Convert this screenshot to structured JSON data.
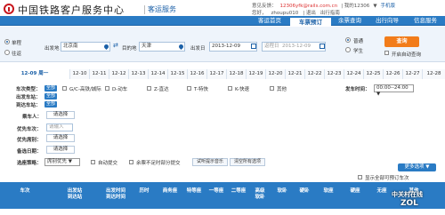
{
  "header": {
    "brand_title": "中国铁路客户服务中心",
    "brand_subtitle": "客运服务",
    "top_links": [
      "意见反馈：",
      "12306yfk@rails.com.cn",
      "| 我的12306",
      "▼",
      "手机版"
    ],
    "user_line": [
      "您好，",
      "zhoupu010",
      "| 退出",
      "出行指南"
    ]
  },
  "nav": {
    "tabs": [
      "客运首页",
      "车票预订",
      "余票查询",
      "出行向导",
      "信息服务"
    ],
    "active_index": 1
  },
  "search": {
    "trip_types": [
      "单程",
      "往返"
    ],
    "trip_selected": 0,
    "from_label": "出发地",
    "from_value": "北京南",
    "to_label": "目的地",
    "to_value": "天津",
    "date_label": "出发日",
    "date_value": "2013-12-09",
    "return_label": "返程日",
    "return_value": "2013-12-09",
    "passenger_types": [
      "普通",
      "学生"
    ],
    "passenger_selected": 0,
    "query_button": "查询",
    "auto_query_label": "开启自动查询"
  },
  "dates": [
    "12-09 周一",
    "12-10",
    "12-11",
    "12-12",
    "12-13",
    "12-14",
    "12-15",
    "12-16",
    "12-17",
    "12-18",
    "12-19",
    "12-20",
    "12-21",
    "12-22",
    "12-23",
    "12-24",
    "12-25",
    "12-26",
    "12-27",
    "12-28"
  ],
  "filters": {
    "train_type_label": "车次类型：",
    "all_label": "全部",
    "train_types": [
      "G/C-高铁/城际",
      "D-动车",
      "Z-直达",
      "T-特快",
      "K-快速",
      "其他"
    ],
    "depart_time_label": "发车时间：",
    "depart_time_value": "00:00--24:00",
    "from_station_label": "出发车站：",
    "to_station_label": "到达车站：",
    "passenger_label": "乘车人：",
    "choose_label": "请选择",
    "priority_train_label": "优先车次：",
    "priority_train_placeholder": "请输入",
    "priority_seat_label": "优先席别：",
    "alt_date_label": "备选日期：",
    "strategy_label": "选座策略：",
    "strategy_value": "席别优先",
    "auto_submit_label": "自动提交",
    "partial_submit_label": "余票不足时部分提交",
    "test_tip_button": "试听提示音乐",
    "clear_button": "清空所有选项",
    "more_button": "更多选项",
    "show_all_label": "显示全部可预订车次"
  },
  "table_headers": [
    "车次",
    "出发站\n到达站",
    "出发时间\n到达时间",
    "历时",
    "商务座",
    "特等座",
    "一等座",
    "二等座",
    "高级\n软卧",
    "软卧",
    "硬卧",
    "软座",
    "硬座",
    "无座",
    "其他"
  ],
  "watermark": {
    "line1": "中关村在线",
    "line2": "ZOL"
  },
  "colors": {
    "primary": "#2a7bc4",
    "accent": "#f27c1a",
    "brand_red": "#c8161d"
  }
}
